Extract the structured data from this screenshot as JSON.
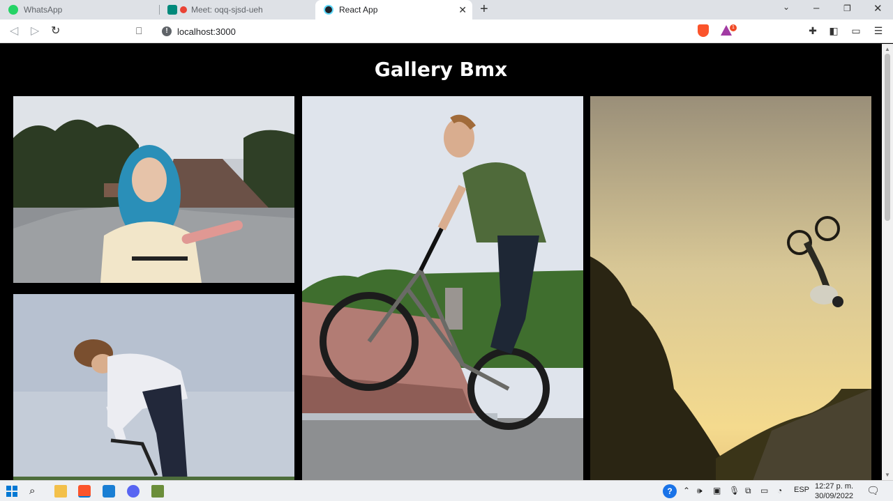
{
  "browser": {
    "tabs": [
      {
        "title": "WhatsApp",
        "active": false,
        "favicon_color": "#25d366"
      },
      {
        "title": "Meet: oqq-sjsd-ueh",
        "active": false,
        "favicon_color": "#00897b",
        "recording_dot": "#ea4335"
      },
      {
        "title": "React App",
        "active": true,
        "favicon_color": "#20232a"
      }
    ],
    "url": "localhost:3000"
  },
  "page": {
    "title": "Gallery Bmx",
    "photos": [
      {
        "description_icon": "photo-girl-blue-hair"
      },
      {
        "description_icon": "photo-bmx-jump-skatepark"
      },
      {
        "description_icon": "photo-bmx-silhouette-sunset"
      },
      {
        "description_icon": "photo-bmx-rider-white-shirt"
      }
    ]
  },
  "taskbar": {
    "language": "ESP",
    "time": "12:27 p. m.",
    "date": "30/09/2022"
  }
}
